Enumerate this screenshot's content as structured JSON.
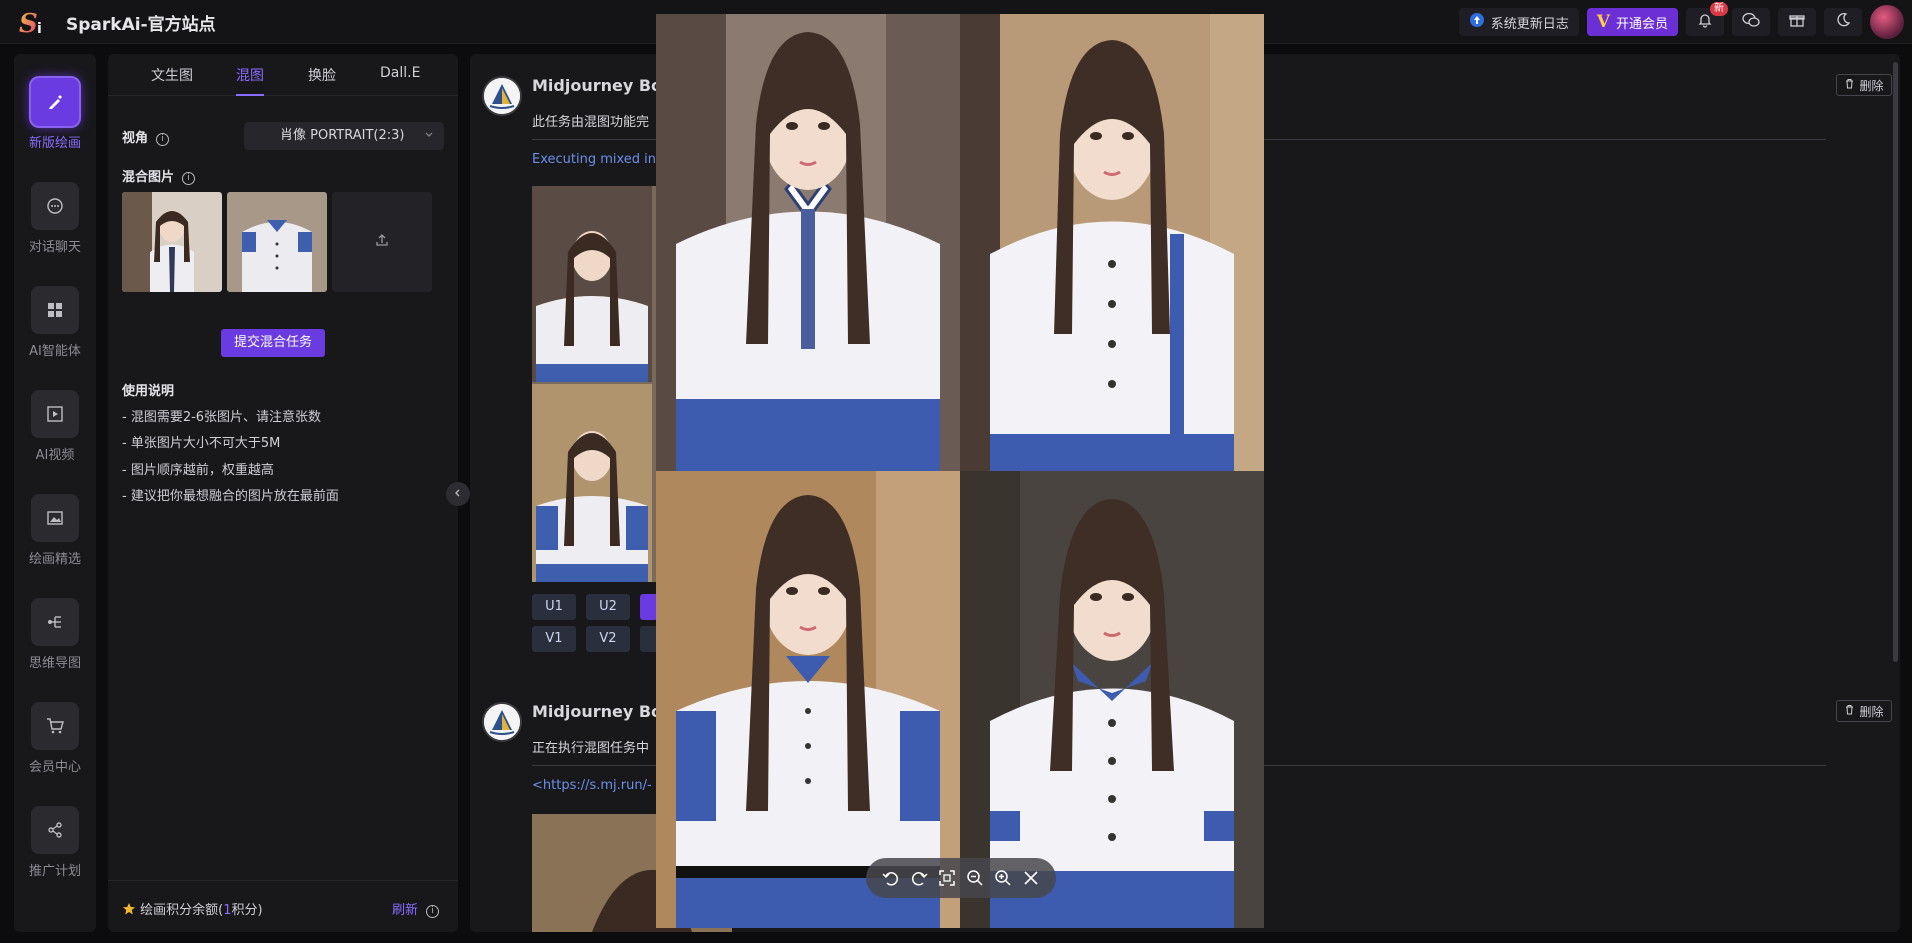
{
  "app": {
    "title": "SparkAi-官方站点"
  },
  "topbar": {
    "changelog_label": "系统更新日志",
    "vip_label": "开通会员",
    "vip_mark": "V",
    "badge_new": "新"
  },
  "nav": {
    "items": [
      {
        "label": "新版绘画",
        "icon": "brush-icon",
        "active": true
      },
      {
        "label": "对话聊天",
        "icon": "chat-icon"
      },
      {
        "label": "AI智能体",
        "icon": "apps-icon"
      },
      {
        "label": "AI视频",
        "icon": "video-icon"
      },
      {
        "label": "绘画精选",
        "icon": "gallery-icon"
      },
      {
        "label": "思维导图",
        "icon": "mindmap-icon"
      },
      {
        "label": "会员中心",
        "icon": "cart-icon"
      },
      {
        "label": "推广计划",
        "icon": "share-icon"
      }
    ]
  },
  "panel": {
    "tabs": [
      "文生图",
      "混图",
      "换脸",
      "Dall.E"
    ],
    "active_tab": "混图",
    "view_label": "视角",
    "view_value": "肖像 PORTRAIT(2:3)",
    "blend_label": "混合图片",
    "submit_label": "提交混合任务",
    "usage_title": "使用说明",
    "usage": [
      "- 混图需要2-6张图片、请注意张数",
      "- 单张图片大小不可大于5M",
      "- 图片顺序越前，权重越高",
      "- 建议把你最想融合的图片放在最前面"
    ],
    "credits_prefix": "绘画积分余额(",
    "credits_value": "1",
    "credits_suffix": "积分)",
    "refresh_label": "刷新",
    "info_glyph": "i"
  },
  "feed": {
    "messages": [
      {
        "bot": "Midjourney Bot",
        "text": "此任务由混图功能完",
        "detail": "Executing mixed in",
        "delete_label": "删除",
        "buttons_row1": [
          "U1",
          "U2"
        ],
        "buttons_row2": [
          "V1",
          "V2"
        ]
      },
      {
        "bot": "Midjourney Bot",
        "text": "正在执行混图任务中",
        "detail": "<https://s.mj.run/-",
        "delete_label": "删除"
      }
    ]
  },
  "colors": {
    "accent": "#6a3be0",
    "accent_text": "#8a6cff",
    "link": "#6b8fe8",
    "bg": "#0c0c0e",
    "panel": "#18181b"
  }
}
